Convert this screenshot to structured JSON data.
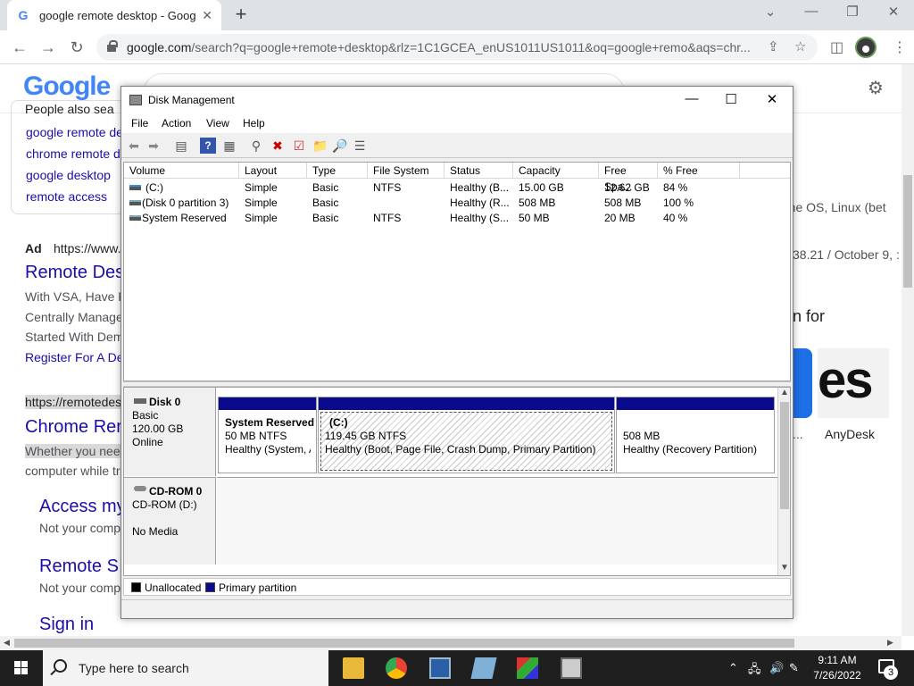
{
  "browser": {
    "tab_title": "google remote desktop - Google",
    "url_host": "google.com",
    "url_rest": "/search?q=google+remote+desktop&rlz=1C1GCEA_enUS1011US1011&oq=google+remo&aqs=chr..."
  },
  "google": {
    "logo": "Google",
    "paa_head": "People also sea",
    "related": [
      "google remote de",
      "chrome remote d",
      "google desktop",
      "remote access"
    ],
    "ad_prefix": "Ad",
    "ad_url": "https://www.",
    "ad_title": "Remote Des",
    "ad_lines": [
      "With VSA, Have F",
      "Centrally Manage",
      "Started With Dem"
    ],
    "ad_link": "Register For A De",
    "result2_url": "https://remotedes",
    "result2_title": "Chrome Rer",
    "result2_line1": "Whether you nee",
    "result2_line2": "computer while tr",
    "sub_results": [
      {
        "title": "Access my",
        "desc": "Not your comp"
      },
      {
        "title": "Remote S",
        "desc": "Not your comp"
      },
      {
        "title": "Sign in",
        "desc": ""
      }
    ],
    "right_snippet1": "ome OS, Linux (bet",
    "right_snippet1_link": "Linux",
    "right_snippet2": "38.21 / October 9, :",
    "right_heading": "n for",
    "anydesk_logo": "es",
    "anydesk_label": "AnyDesk",
    "dots": "..."
  },
  "disk_mgmt": {
    "title": "Disk Management",
    "menu": [
      "File",
      "Action",
      "View",
      "Help"
    ],
    "columns": [
      "Volume",
      "Layout",
      "Type",
      "File System",
      "Status",
      "Capacity",
      "Free Spa...",
      "% Free"
    ],
    "volumes": [
      {
        "volume": "(C:)",
        "layout": "Simple",
        "type": "Basic",
        "fs": "NTFS",
        "status": "Healthy (B...",
        "capacity": "15.00 GB",
        "free": "12.62 GB",
        "pct": "84 %"
      },
      {
        "volume": "(Disk 0 partition 3)",
        "layout": "Simple",
        "type": "Basic",
        "fs": "",
        "status": "Healthy (R...",
        "capacity": "508 MB",
        "free": "508 MB",
        "pct": "100 %"
      },
      {
        "volume": "System Reserved",
        "layout": "Simple",
        "type": "Basic",
        "fs": "NTFS",
        "status": "Healthy (S...",
        "capacity": "50 MB",
        "free": "20 MB",
        "pct": "40 %"
      }
    ],
    "disk0": {
      "name": "Disk 0",
      "type": "Basic",
      "size": "120.00 GB",
      "state": "Online",
      "partitions": [
        {
          "name": "System Reserved",
          "size_fs": "50 MB NTFS",
          "status": "Healthy (System, A"
        },
        {
          "name": "(C:)",
          "size_fs": "119.45 GB NTFS",
          "status": "Healthy (Boot, Page File, Crash Dump, Primary Partition)"
        },
        {
          "name": "",
          "size_fs": "508 MB",
          "status": "Healthy (Recovery Partition)"
        }
      ]
    },
    "cdrom": {
      "name": "CD-ROM 0",
      "drive": "CD-ROM (D:)",
      "media": "No Media"
    },
    "legend": [
      {
        "label": "Unallocated",
        "color": "#000000"
      },
      {
        "label": "Primary partition",
        "color": "#0a0a8c"
      }
    ]
  },
  "taskbar": {
    "search_placeholder": "Type here to search",
    "time": "9:11 AM",
    "date": "7/26/2022",
    "notifications": "3"
  }
}
